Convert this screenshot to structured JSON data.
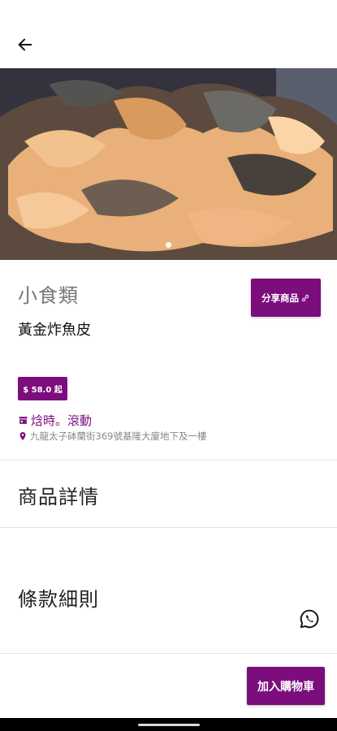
{
  "header": {
    "back_icon": "arrow-left-icon"
  },
  "hero": {
    "image_description_icon": "product-photo",
    "slide_count": 1,
    "active_slide": 1
  },
  "product": {
    "category": "小食類",
    "name": "黃金炸魚皮",
    "price": "$ 58.0 起",
    "share_label": "分享商品",
    "share_icon": "link-icon"
  },
  "shop": {
    "name": "焓時。滾動",
    "shop_icon": "store-icon",
    "address": "九龍太子砵蘭街369號基隆大廈地下及一樓",
    "address_icon": "location-pin-icon"
  },
  "sections": {
    "details_title": "商品詳情",
    "terms_title": "條款細則"
  },
  "actions": {
    "add_to_cart_label": "加入購物車",
    "whatsapp_icon": "whatsapp-icon"
  },
  "colors": {
    "accent": "#7b0d7d",
    "muted_text": "#888888"
  }
}
